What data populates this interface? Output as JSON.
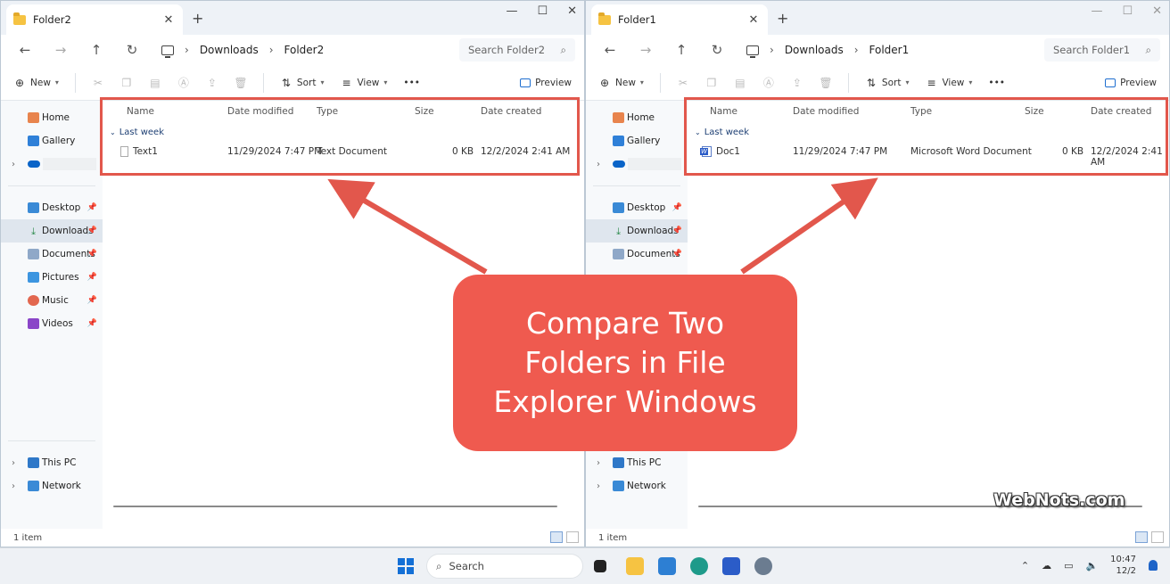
{
  "windows": {
    "left": {
      "tab_title": "Folder2",
      "breadcrumb": [
        "Downloads",
        "Folder2"
      ],
      "search_placeholder": "Search Folder2",
      "group_label": "Last week",
      "file": {
        "name": "Text1",
        "modified": "11/29/2024 7:47 PM",
        "type": "Text Document",
        "size": "0 KB",
        "created": "12/2/2024 2:41 AM"
      },
      "status": "1 item"
    },
    "right": {
      "tab_title": "Folder1",
      "breadcrumb": [
        "Downloads",
        "Folder1"
      ],
      "search_placeholder": "Search Folder1",
      "group_label": "Last week",
      "file": {
        "name": "Doc1",
        "modified": "11/29/2024 7:47 PM",
        "type": "Microsoft Word Document",
        "size": "0 KB",
        "created": "12/2/2024 2:41 AM"
      },
      "status": "1 item"
    }
  },
  "toolbar": {
    "new": "New",
    "sort": "Sort",
    "view": "View",
    "more": "•••",
    "preview": "Preview"
  },
  "columns": {
    "name": "Name",
    "modified": "Date modified",
    "type": "Type",
    "size": "Size",
    "created": "Date created"
  },
  "sidebar": {
    "home": "Home",
    "gallery": "Gallery",
    "desktop": "Desktop",
    "downloads": "Downloads",
    "documents": "Documents",
    "pictures": "Pictures",
    "music": "Music",
    "videos": "Videos",
    "this_pc": "This PC",
    "network": "Network"
  },
  "callout": "Compare Two Folders in File Explorer Windows",
  "watermark": "WebNots.com",
  "taskbar": {
    "search": "Search",
    "time": "10:47",
    "date": "12/2"
  },
  "colors": {
    "highlight": "#e2574c",
    "callout": "#ef5a4f",
    "accent": "#1470d6"
  }
}
